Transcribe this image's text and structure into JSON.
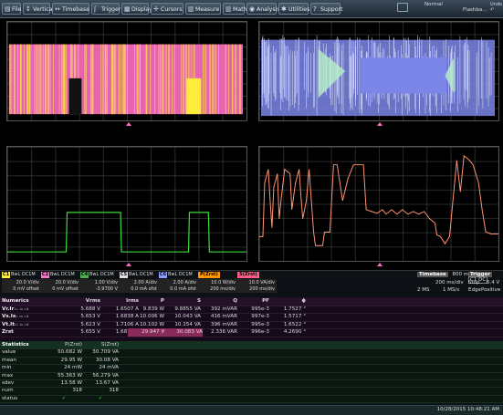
{
  "menu": {
    "items": [
      {
        "label": "File",
        "icon": "file-icon",
        "glyph": "▤"
      },
      {
        "label": "Vertical",
        "icon": "vertical-icon",
        "glyph": "↕"
      },
      {
        "label": "Timebase",
        "icon": "timebase-icon",
        "glyph": "↔"
      },
      {
        "label": "Trigger",
        "icon": "trigger-icon",
        "glyph": "ʃ"
      },
      {
        "label": "Display",
        "icon": "display-icon",
        "glyph": "▦"
      },
      {
        "label": "Cursors",
        "icon": "cursors-icon",
        "glyph": "✛"
      },
      {
        "label": "Measure",
        "icon": "measure-icon",
        "glyph": "▥"
      },
      {
        "label": "Math",
        "icon": "math-icon",
        "glyph": "▥"
      },
      {
        "label": "Analysis",
        "icon": "analysis-icon",
        "glyph": "◉"
      },
      {
        "label": "Utilities",
        "icon": "utilities-icon",
        "glyph": "✱"
      },
      {
        "label": "Support",
        "icon": "support-icon",
        "glyph": "?"
      }
    ],
    "mode": "Normal",
    "flashback": "Flashba..."
  },
  "channels": [
    {
      "tag": "C1",
      "color": "#ffeb3b",
      "coupling": "BwL DC1M",
      "scale": "20.0 V/div",
      "offset": "0 mV offset"
    },
    {
      "tag": "C2",
      "color": "#ff6ec7",
      "coupling": "BwL DC1M",
      "scale": "20.0 V/div",
      "offset": "0 mV offset"
    },
    {
      "tag": "C4",
      "color": "#4caf50",
      "coupling": "BwL DC1M",
      "scale": "1.00 V/div",
      "offset": "-3.9700 V"
    },
    {
      "tag": "C5",
      "color": "#e0e0e0",
      "coupling": "BwL DC1M",
      "scale": "2.00 A/div",
      "offset": "0.0 mA ofst"
    },
    {
      "tag": "C6",
      "color": "#8c9eff",
      "coupling": "BwL DC1M",
      "scale": "2.00 A/div",
      "offset": "0.0 mA ofst"
    },
    {
      "tag": "P(Zrst)",
      "color": "#ff9800",
      "coupling": "",
      "scale": "10.0 W/div",
      "offset": "200 ms/div"
    },
    {
      "tag": "S(Zrst)",
      "color": "#ff5c8a",
      "coupling": "",
      "scale": "10.0 VA/div",
      "offset": "200 ms/div"
    }
  ],
  "timebase": {
    "label": "Timebase",
    "delay": "800 ms",
    "scale": "200 ms/div",
    "samples": "2 MS",
    "rate": "1 MS/s"
  },
  "trigger": {
    "label": "Trigger",
    "source": "C1 DC",
    "mode": "Stop",
    "type": "Edge",
    "level": "6.4 V",
    "slope": "Positive"
  },
  "numerics": {
    "title": "Numerics",
    "headers": [
      "Vrms",
      "Irms",
      "P",
      "S",
      "Q",
      "PF",
      "ϕ"
    ],
    "rows": [
      {
        "name": "Vr.Ir",
        "sub": "LL to LN",
        "values": [
          "5.688 V",
          "1.6507 A",
          "9.839 W",
          "9.8855 VA",
          "392 mVAR",
          "995e-3",
          "1.7527 °"
        ]
      },
      {
        "name": "Vs.Is",
        "sub": "LL to LN",
        "values": [
          "5.653 V",
          "1.6838 A",
          "10.006 W",
          "10.043 VA",
          "416 mVAR",
          "997e-3",
          "1.5717 °"
        ]
      },
      {
        "name": "Vt.It",
        "sub": "LL to LN",
        "values": [
          "5.623 V",
          "1.7106 A",
          "10.102 W",
          "10.154 VA",
          "396 mVAR",
          "995e-3",
          "1.6522 °"
        ]
      },
      {
        "name": "Zrst",
        "sub": "",
        "values": [
          "5.655 V",
          "1.6817 A",
          "29.947 W",
          "30.083 VA",
          "2.336 VAR",
          "996e-3",
          "4.2690 °"
        ]
      }
    ]
  },
  "statistics": {
    "title": "Statistics",
    "col_headers": [
      "P(Zrst)",
      "S(Zrst)"
    ],
    "rows": [
      {
        "label": "value",
        "values": [
          "50.682 W",
          "50.709 VA"
        ]
      },
      {
        "label": "mean",
        "values": [
          "29.95 W",
          "30.08 VA"
        ]
      },
      {
        "label": "min",
        "values": [
          "24 mW",
          "24 mVA"
        ]
      },
      {
        "label": "max",
        "values": [
          "55.363 W",
          "56.279 VA"
        ]
      },
      {
        "label": "sdev",
        "values": [
          "13.58 W",
          "13.67 VA"
        ]
      },
      {
        "label": "num",
        "values": [
          "318",
          "318"
        ]
      },
      {
        "label": "status",
        "values": [
          "✓",
          "✓"
        ]
      }
    ]
  },
  "status_bar": {
    "datetime": "10/28/2015 10:48:21 AM"
  }
}
